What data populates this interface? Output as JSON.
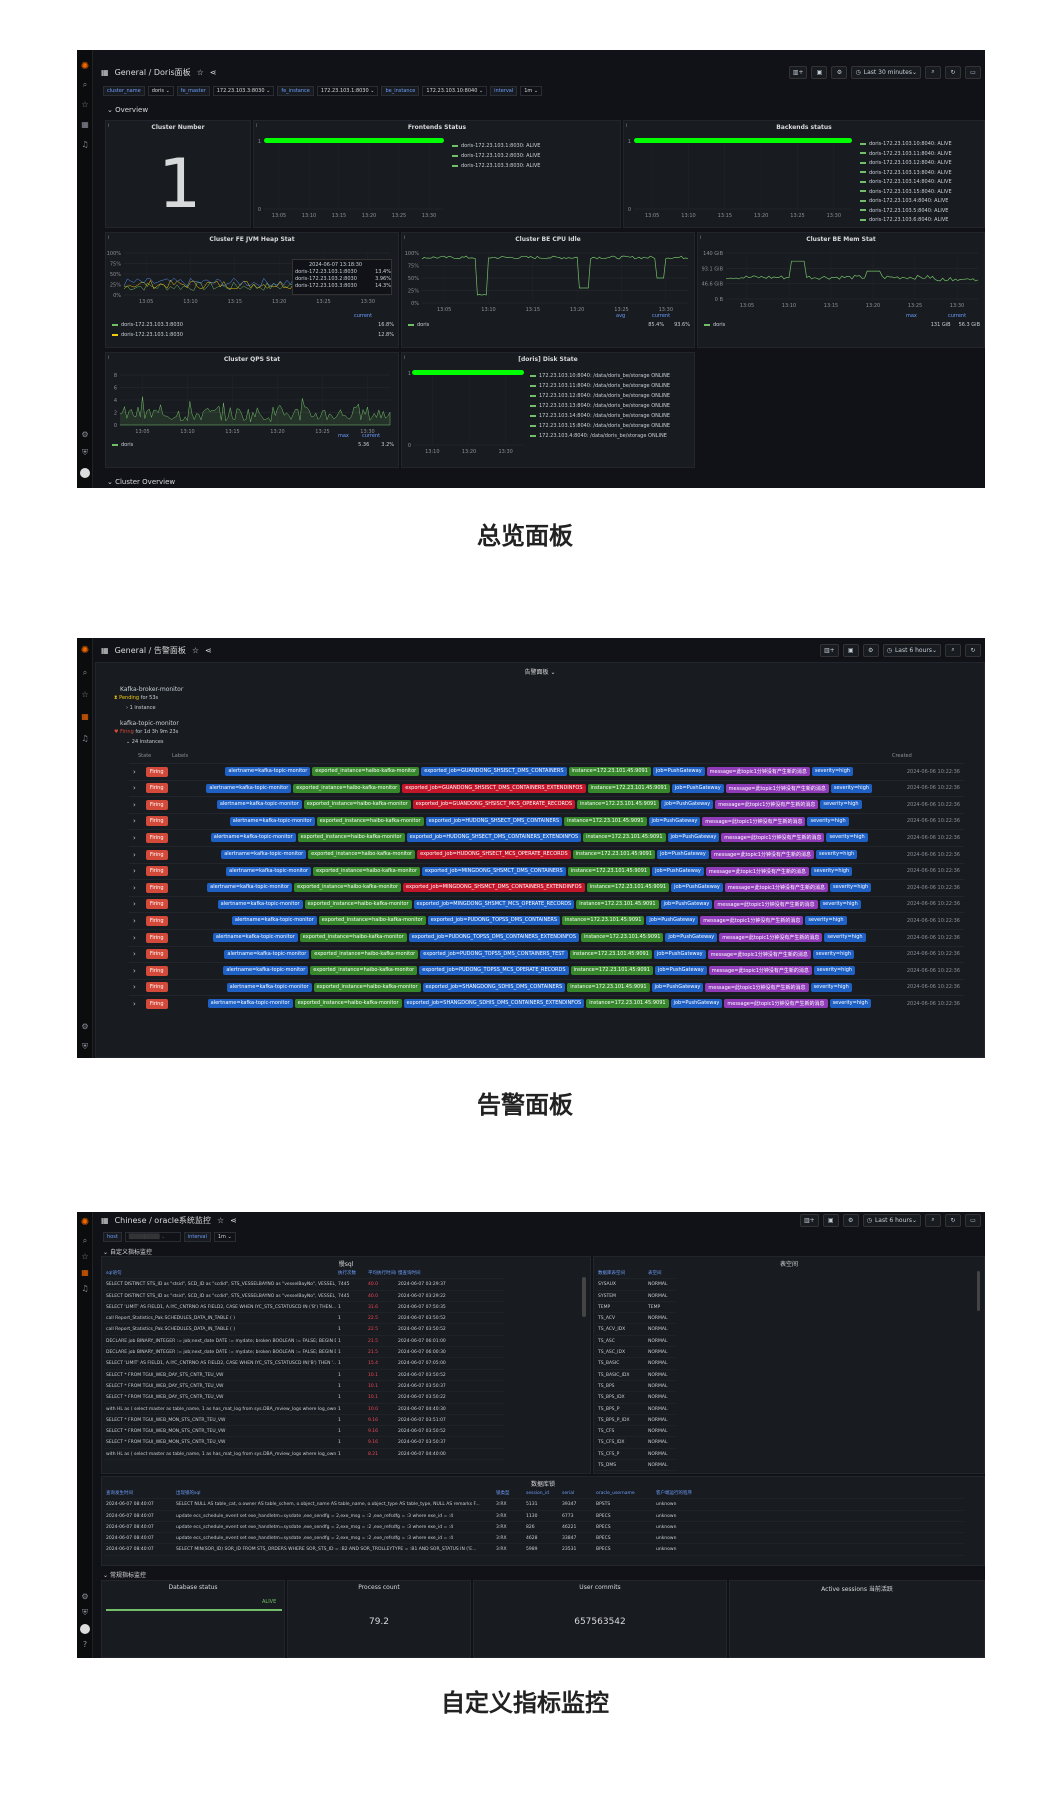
{
  "captions": {
    "overview": "总览面板",
    "alerts": "告警面板",
    "custom": "自定义指标监控"
  },
  "colors": {
    "bg": "#111217",
    "panel": "#181b1f",
    "green": "#73bf69",
    "bright_green": "#00ff00",
    "firing": "#d44a3a",
    "accent": "#6e9fff"
  },
  "overview": {
    "breadcrumb": "General / Doris面板",
    "time_picker": "Last 30 minutes",
    "vars": [
      {
        "label": "cluster_name",
        "value": "doris"
      },
      {
        "label": "fe_master",
        "value": "172.23.103.3:8030"
      },
      {
        "label": "fe_instance",
        "value": "172.23.103.1:8030"
      },
      {
        "label": "be_instance",
        "value": "172.23.103.10:8040"
      },
      {
        "label": "interval",
        "value": "1m"
      }
    ],
    "row_overview": "Overview",
    "row_cluster": "Cluster Overview",
    "cluster_number": {
      "title": "Cluster Number",
      "value": "1"
    },
    "frontends": {
      "title": "Frontends Status",
      "legend": [
        "doris-172.23.103.1:8030: ALIVE",
        "doris-172.23.103.2:8030: ALIVE",
        "doris-172.23.103.3:8030: ALIVE"
      ],
      "x_ticks": [
        "13:05",
        "13:10",
        "13:15",
        "13:20",
        "13:25",
        "13:30"
      ],
      "y_ticks": [
        "1",
        "0"
      ]
    },
    "backends": {
      "title": "Backends status",
      "legend": [
        "doris-172.23.103.10:8040: ALIVE",
        "doris-172.23.103.11:8040: ALIVE",
        "doris-172.23.103.12:8040: ALIVE",
        "doris-172.23.103.13:8040: ALIVE",
        "doris-172.23.103.14:8040: ALIVE",
        "doris-172.23.103.15:8040: ALIVE",
        "doris-172.23.103.4:8040: ALIVE",
        "doris-172.23.103.5:8040: ALIVE",
        "doris-172.23.103.6:8040: ALIVE"
      ],
      "x_ticks": [
        "13:05",
        "13:10",
        "13:15",
        "13:20",
        "13:25",
        "13:30"
      ],
      "y_ticks": [
        "1",
        "0"
      ]
    },
    "jvm": {
      "title": "Cluster FE JVM Heap Stat",
      "y_ticks": [
        "100%",
        "75%",
        "50%",
        "25%",
        "0%"
      ],
      "x_ticks": [
        "13:05",
        "13:10",
        "13:15",
        "13:20",
        "13:25",
        "13:30"
      ],
      "tooltip_time": "2024-06-07 13:18:30",
      "tooltip": [
        {
          "name": "doris-172.23.103.1:8030",
          "val": "13.4%"
        },
        {
          "name": "doris-172.23.103.2:8030",
          "val": "3.96%"
        },
        {
          "name": "doris-172.23.103.3:8030",
          "val": "14.3%"
        }
      ],
      "legend_head": "current",
      "legend": [
        {
          "name": "doris-172.23.103.3:8030",
          "val": "16.8%"
        },
        {
          "name": "doris-172.23.103.1:8030",
          "val": "12.8%"
        }
      ]
    },
    "cpu": {
      "title": "Cluster BE CPU Idle",
      "y_ticks": [
        "100%",
        "75%",
        "50%",
        "25%",
        "0%"
      ],
      "x_ticks": [
        "13:05",
        "13:10",
        "13:15",
        "13:20",
        "13:25",
        "13:30"
      ],
      "legend_head": [
        "avg",
        "current"
      ],
      "legend": [
        {
          "name": "doris",
          "avg": "85.4%",
          "cur": "93.6%"
        }
      ]
    },
    "mem": {
      "title": "Cluster BE Mem Stat",
      "y_ticks": [
        "140 GiB",
        "93.1 GiB",
        "46.6 GiB",
        "0 B"
      ],
      "x_ticks": [
        "13:05",
        "13:10",
        "13:15",
        "13:20",
        "13:25",
        "13:30"
      ],
      "legend_head": [
        "max",
        "current"
      ],
      "legend": [
        {
          "name": "doris",
          "max": "131 GiB",
          "cur": "56.3 GiB"
        }
      ]
    },
    "qps": {
      "title": "Cluster QPS Stat",
      "y_ticks": [
        "8",
        "6",
        "4",
        "2",
        "0"
      ],
      "x_ticks": [
        "13:05",
        "13:10",
        "13:15",
        "13:20",
        "13:25",
        "13:30"
      ],
      "legend_head": [
        "max",
        "current"
      ],
      "legend": [
        {
          "name": "doris",
          "max": "5.36",
          "cur": "3.2%"
        }
      ]
    },
    "disk": {
      "title": "[doris] Disk State",
      "y_ticks": [
        "1",
        "0"
      ],
      "x_ticks": [
        "13:10",
        "13:20",
        "13:30"
      ],
      "legend": [
        "172.23.103.10:8040: /data/doris_be/storage ONLINE",
        "172.23.103.11:8040: /data/doris_be/storage ONLINE",
        "172.23.103.12:8040: /data/doris_be/storage ONLINE",
        "172.23.103.13:8040: /data/doris_be/storage ONLINE",
        "172.23.103.14:8040: /data/doris_be/storage ONLINE",
        "172.23.103.15:8040: /data/doris_be/storage ONLINE",
        "172.23.103.4:8040: /data/doris_be/storage ONLINE"
      ]
    }
  },
  "alerts": {
    "breadcrumb": "General / 告警面板",
    "time_picker": "Last 6 hours",
    "section": "告警面板",
    "group1": {
      "name": "Kafka-broker-monitor",
      "state": "Pending",
      "for": "for 53s",
      "instances": "1 instance"
    },
    "group2": {
      "name": "kafka-topic-monitor",
      "state": "Firing",
      "for": "for 1d 3h 9m 23s",
      "instances": "24 instances"
    },
    "col_state": "State",
    "col_labels": "Labels",
    "col_created": "Created",
    "state_label": "Firing",
    "rows": [
      {
        "job": "exported_job=GUANDONG_SHSISCT_DMS_CONTAINERS",
        "created": "2024-06-06 10:22:36",
        "red": false
      },
      {
        "job": "exported_job=GUANDONG_SHSISCT_DMS_CONTAINERS_EXTENDINFOS",
        "created": "2024-06-06 10:22:36",
        "red": true
      },
      {
        "job": "exported_job=GUANDONG_SHSISCT_MCS_OPERATE_RECORDS",
        "created": "2024-06-06 10:22:36",
        "red": true
      },
      {
        "job": "exported_job=HUDONG_SHSECT_DMS_CONTAINERS",
        "created": "2024-06-06 10:22:36",
        "red": false
      },
      {
        "job": "exported_job=HUDONG_SHSECT_DMS_CONTAINERS_EXTENDINFOS",
        "created": "2024-06-06 10:22:36",
        "red": false
      },
      {
        "job": "exported_job=HUDONG_SHSECT_MCS_OPERATE_RECORDS",
        "created": "2024-06-06 10:22:36",
        "red": true
      },
      {
        "job": "exported_job=MINGDONG_SHSMCT_DMS_CONTAINERS",
        "created": "2024-06-06 10:22:36",
        "red": false
      },
      {
        "job": "exported_job=MINGDONG_SHSMCT_DMS_CONTAINERS_EXTENDINFOS",
        "created": "2024-06-06 10:22:36",
        "red": true
      },
      {
        "job": "exported_job=MINGDONG_SHSMCT_MCS_OPERATE_RECORDS",
        "created": "2024-06-06 10:22:36",
        "red": false
      },
      {
        "job": "exported_job=PUDONG_TOPSS_DMS_CONTAINERS",
        "created": "2024-06-06 10:22:36",
        "red": false
      },
      {
        "job": "exported_job=PUDONG_TOPSS_DMS_CONTAINERS_EXTENDINFOS",
        "created": "2024-06-06 10:22:36",
        "red": false
      },
      {
        "job": "exported_job=PUDONG_TOPSS_DMS_CONTAINERS_TEST",
        "created": "2024-06-06 10:22:36",
        "red": false
      },
      {
        "job": "exported_job=PUDONG_TOPSS_MCS_OPERATE_RECORDS",
        "created": "2024-06-06 10:22:36",
        "red": false
      },
      {
        "job": "exported_job=SHANGDONG_SDHIS_DMS_CONTAINERS",
        "created": "2024-06-06 10:22:36",
        "red": false
      },
      {
        "job": "exported_job=SHANGDONG_SDHIS_DMS_CONTAINERS_EXTENDINFOS",
        "created": "2024-06-06 10:22:36",
        "red": false
      }
    ],
    "tag_alertname": "alertname=kafka-topic-monitor",
    "tag_instance_name": "exported_instance=haibo-kafka-monitor",
    "tag_instance": "instance=172.23.101.45:9091",
    "tag_job": "job=PushGateway",
    "tag_message": "message=此topic1分钟没有产生新的消息",
    "tag_severity": "severity=high"
  },
  "custom": {
    "breadcrumb": "Chinese / oracle系统监控",
    "time_picker": "Last 6 hours",
    "var_host_label": "host",
    "var_interval_label": "interval",
    "var_interval_value": "1m",
    "row1": "自定义指标监控",
    "sql_panel_title": "慢sql",
    "sql_cols": [
      "sql语句",
      "执行次数",
      "平均执行时间(s)",
      "慢查询时间"
    ],
    "sql_rows": [
      [
        "SELECT DISTINCT STS_ID as \"stsid\", SCD_ID as \"scdid\", STS_VESSELBAYNO as \"vesselBayNo\", VESSEL_...",
        "7445",
        "40.0",
        "2024-06-07 03:29:37"
      ],
      [
        "SELECT DISTINCT STS_ID as \"stsid\", SCD_ID as \"scdid\", STS_VESSELBAYNO as \"vesselBayNo\", VESSEL_...",
        "7445",
        "40.0",
        "2024-06-07 03:29:22"
      ],
      [
        "SELECT 'LIMIT' AS FIELD1, A.IYC_CNTRNO AS FIELD2, CASE WHEN IYC_STS_CSTATUSCD IN ('B') THEN...",
        "1",
        "31.6",
        "2024-06-07 07:50:35"
      ],
      [
        "call Report_Statistics_Pak.SCHEDULES_DATA_IN_TABLE ( )",
        "1",
        "22.5",
        "2024-06-07 03:50:52"
      ],
      [
        "call Report_Statistics_Pak.SCHEDULES_DATA_IN_TABLE ( )",
        "1",
        "22.5",
        "2024-06-07 03:50:52"
      ],
      [
        "DECLARE job BINARY_INTEGER := job;next_date DATE := mydate; broken BOOLEAN := FALSE; BEGIN D...",
        "1",
        "21.5",
        "2024-06-07 06:01:00"
      ],
      [
        "DECLARE job BINARY_INTEGER := job;next_date DATE := mydate; broken BOOLEAN := FALSE; BEGIN D...",
        "1",
        "21.5",
        "2024-06-07 06:00:30"
      ],
      [
        "SELECT 'LIMIT' AS FIELD1, A.IYC_CNTRNO AS FIELD2, CASE WHEN IYC_STS_CSTATUSCD IN('B') THEN '...",
        "1",
        "15.4",
        "2024-06-07 07:05:00"
      ],
      [
        "SELECT * FROM TGUI_WEB_DAY_STS_CNTR_TEU_VW",
        "1",
        "10.1",
        "2024-06-07 03:50:52"
      ],
      [
        "SELECT * FROM TGUI_WEB_DAY_STS_CNTR_TEU_VW",
        "1",
        "10.1",
        "2024-06-07 03:50:37"
      ],
      [
        "SELECT * FROM TGUI_WEB_DAY_STS_CNTR_TEU_VW",
        "1",
        "10.1",
        "2024-06-07 03:50:22"
      ],
      [
        "with HL as ( select master as table_name, 1 as has_mat_log from sys.DBA_mview_logs where log_owner...",
        "1",
        "10.0",
        "2024-06-07 04:40:30"
      ],
      [
        "SELECT * FROM TGUI_WEB_MON_STS_CNTR_TEU_VW",
        "1",
        "9.16",
        "2024-06-07 03:51:07"
      ],
      [
        "SELECT * FROM TGUI_WEB_MON_STS_CNTR_TEU_VW",
        "1",
        "9.16",
        "2024-06-07 03:50:52"
      ],
      [
        "SELECT * FROM TGUI_WEB_MON_STS_CNTR_TEU_VW",
        "1",
        "9.16",
        "2024-06-07 03:50:37"
      ],
      [
        "with HL as ( select master as table_name, 1 as has_mat_log from sys.DBA_mview_logs where log_owner...",
        "1",
        "8.21",
        "2024-06-07 04:40:00"
      ]
    ],
    "ts_panel_title": "表空间",
    "ts_cols": [
      "数据库表空间",
      "表空间"
    ],
    "ts_rows": [
      [
        "SYSAUX",
        "NORMAL"
      ],
      [
        "SYSTEM",
        "NORMAL"
      ],
      [
        "TEMP",
        "TEMP"
      ],
      [
        "TS_ACV",
        "NORMAL"
      ],
      [
        "TS_ACV_IDX",
        "NORMAL"
      ],
      [
        "TS_ASC",
        "NORMAL"
      ],
      [
        "TS_ASC_IDX",
        "NORMAL"
      ],
      [
        "TS_BASIC",
        "NORMAL"
      ],
      [
        "TS_BASIC_IDX",
        "NORMAL"
      ],
      [
        "TS_BPS",
        "NORMAL"
      ],
      [
        "TS_BPS_IDX",
        "NORMAL"
      ],
      [
        "TS_BPS_P",
        "NORMAL"
      ],
      [
        "TS_BPS_P_IDX",
        "NORMAL"
      ],
      [
        "TS_CFS",
        "NORMAL"
      ],
      [
        "TS_CFS_IDX",
        "NORMAL"
      ],
      [
        "TS_CFS_P",
        "NORMAL"
      ],
      [
        "TS_DMS",
        "NORMAL"
      ]
    ],
    "lock_panel_title": "数据库锁",
    "lock_cols": [
      "查询发生时间",
      "出现锁的sql",
      "锁类型",
      "session_id",
      "serial",
      "oracle_username",
      "客户端运行的程序"
    ],
    "lock_rows": [
      [
        "2024-06-07 08:40:07",
        "SELECT NULL AS table_cat, o.owner AS table_schem, o.object_name AS table_name, o.object_type AS table_type, NULL AS remarks F...",
        "3:RX",
        "5131",
        "39347",
        "BPSTS",
        "unknown"
      ],
      [
        "2024-06-07 08:40:07",
        "update ecs_schedule_event set exe_handletm=sysdate ,exe_sendfg = 2,exe_msg = :2 ,exe_refsdfg = :3 where exe_id = :4",
        "3:RX",
        "1130",
        "6773",
        "BPECS",
        "unknown"
      ],
      [
        "2024-06-07 08:40:07",
        "update ecs_schedule_event set exe_handletm=sysdate ,exe_sendfg = 2,exe_msg = :2 ,exe_refsdfg = :3 where exe_id = :4",
        "3:RX",
        "826",
        "46221",
        "BPECS",
        "unknown"
      ],
      [
        "2024-06-07 08:40:07",
        "update ecs_schedule_event set exe_handletm=sysdate ,exe_sendfg = 2,exe_msg = :2 ,exe_refsdfg = :3 where exe_id = :4",
        "3:RX",
        "4628",
        "33847",
        "BPECS",
        "unknown"
      ],
      [
        "2024-06-07 08:40:07",
        "SELECT MIN(SOR_ID) SOR_ID FROM STS_ORDERS WHERE SOR_STS_ID = :B2 AND SOR_TROLLEYTYPE = :B1 AND SOR_STATUS IN ('E...",
        "3:RX",
        "5989",
        "23531",
        "BPECS",
        "unknown"
      ]
    ],
    "row2": "常规指标监控",
    "stat_db": {
      "title": "Database status",
      "label": "ALIVE"
    },
    "stat_proc": {
      "title": "Process count",
      "value": "79.2"
    },
    "stat_commit": {
      "title": "User commits",
      "value": "657563542"
    },
    "stat_active": {
      "title": "Active sessions 当前活跃"
    }
  }
}
